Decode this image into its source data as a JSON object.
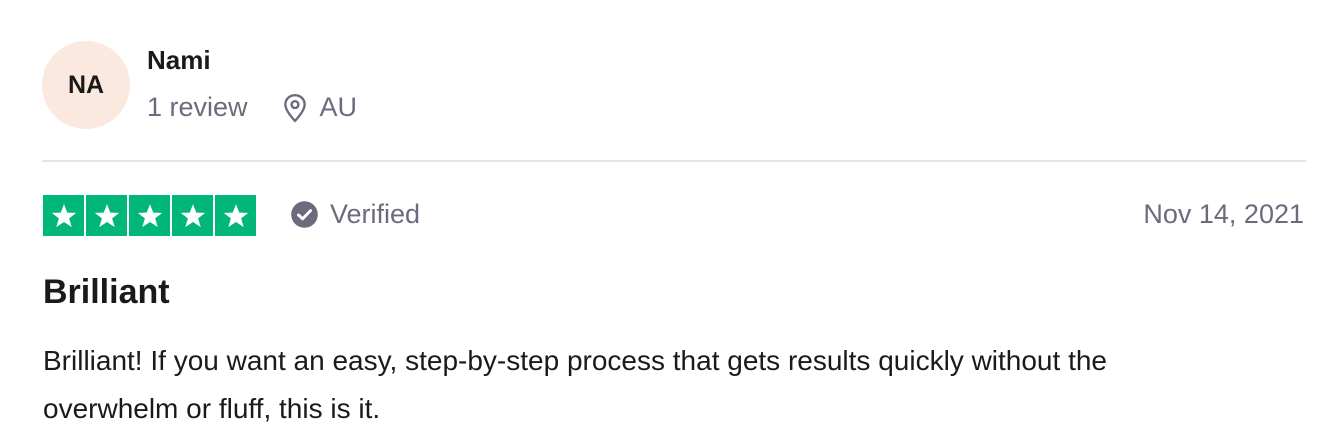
{
  "reviewer": {
    "initials": "NA",
    "name": "Nami",
    "review_count": "1 review",
    "location_icon": "location-pin-icon",
    "location": "AU",
    "avatar_bg": "#fbe9df"
  },
  "review": {
    "rating": 5,
    "rating_max": 5,
    "star_color": "#00b67a",
    "verified_icon": "check-circle-icon",
    "verified_label": "Verified",
    "date": "Nov 14, 2021",
    "title": "Brilliant",
    "body": "Brilliant! If you want an easy, step-by-step process that gets results quickly without the overwhelm or fluff, this is it."
  }
}
